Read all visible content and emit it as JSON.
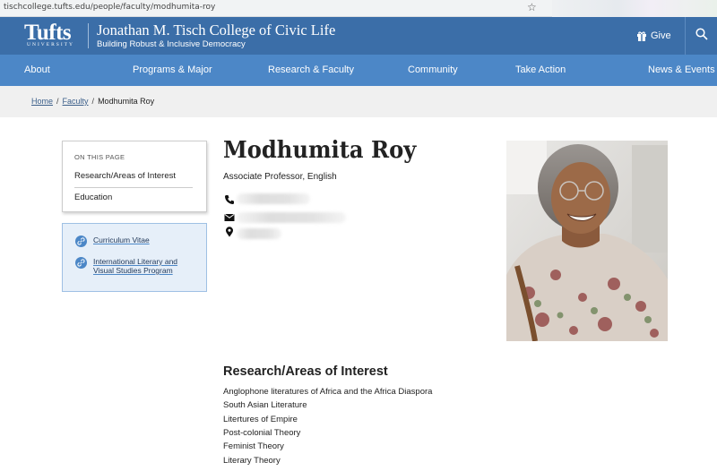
{
  "browser": {
    "url": "tischcollege.tufts.edu/people/faculty/modhumita-roy"
  },
  "header": {
    "logo_text": "Tufts",
    "logo_sub": "UNIVERSITY",
    "site_title": "Jonathan M. Tisch College of Civic Life",
    "site_subtitle": "Building Robust & Inclusive Democracy",
    "give_label": "Give"
  },
  "nav": {
    "items": [
      {
        "label": "About"
      },
      {
        "label": "Programs & Major"
      },
      {
        "label": "Research & Faculty"
      },
      {
        "label": "Community"
      },
      {
        "label": "Take Action"
      },
      {
        "label": "News & Events"
      }
    ]
  },
  "breadcrumb": {
    "home": "Home",
    "faculty": "Faculty",
    "current": "Modhumita Roy",
    "separator": "/"
  },
  "toc": {
    "heading": "ON THIS PAGE",
    "items": [
      {
        "label": "Research/Areas of Interest"
      },
      {
        "label": "Education"
      }
    ]
  },
  "links": {
    "items": [
      {
        "label": "Curriculum Vitae"
      },
      {
        "label": "International Literary and Visual Studies Program"
      }
    ]
  },
  "profile": {
    "name": "Modhumita Roy",
    "title": "Associate Professor, English"
  },
  "research": {
    "heading": "Research/Areas of Interest",
    "items": [
      "Anglophone literatures of Africa and the Africa Diaspora",
      "South Asian Literature",
      "Litertures of Empire",
      "Post-colonial Theory",
      "Feminist Theory",
      "Literary Theory"
    ]
  },
  "colors": {
    "header_bg": "#3b6ea8",
    "nav_bg": "#4c87c7",
    "breadcrumb_bg": "#f0f0f0",
    "links_box_bg": "#e6eff9"
  }
}
